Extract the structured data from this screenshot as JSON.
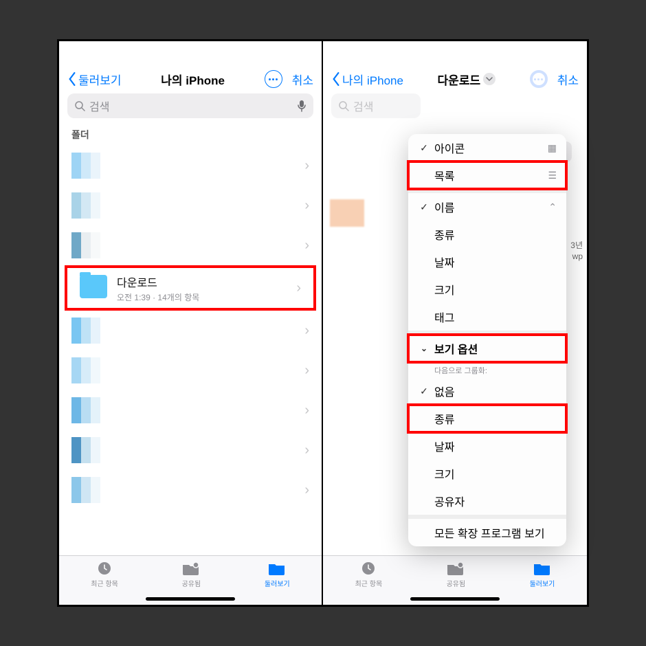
{
  "left": {
    "back": "둘러보기",
    "title": "나의 iPhone",
    "cancel": "취소",
    "search_placeholder": "검색",
    "section": "폴더",
    "download_row": {
      "title": "다운로드",
      "sub": "오전 1:39 · 14개의 항목"
    }
  },
  "right": {
    "back": "나의 iPhone",
    "title": "다운로드",
    "cancel": "취소",
    "search_placeholder": "검색",
    "menu": {
      "icons": "아이콘",
      "list": "목록",
      "name": "이름",
      "kind": "종류",
      "date": "날짜",
      "size": "크기",
      "tag": "태그",
      "view_options": "보기 옵션",
      "group_by": "다음으로 그룹화:",
      "none": "없음",
      "g_kind": "종류",
      "g_date": "날짜",
      "g_size": "크기",
      "g_shared": "공유자",
      "show_ext": "모든 확장 프로그램 보기"
    },
    "snippet1": "3년",
    "snippet2": "wp"
  },
  "tabs": {
    "recent": "최근 항목",
    "shared": "공유됨",
    "browse": "둘러보기"
  },
  "pxcolors": [
    [
      "#9ed4f5",
      "#cfe9f9",
      "#eaf4fb"
    ],
    [
      "#a9d3e8",
      "#d3e8f4",
      "#f0f7fb"
    ],
    [
      "#6fa8c7",
      "#e9eef1",
      "#f7f9fa"
    ],
    [
      "#79c6f2",
      "#bfe2f6",
      "#e7f3fb"
    ],
    [
      "#a6d7f4",
      "#d7ecf9",
      "#f1f8fc"
    ],
    [
      "#6db7e6",
      "#b9ddf3",
      "#e4f2fa"
    ],
    [
      "#4e94c4",
      "#c5e0ef",
      "#eef6fb"
    ],
    [
      "#8cc7ea",
      "#cfe6f4",
      "#f0f7fb"
    ]
  ]
}
